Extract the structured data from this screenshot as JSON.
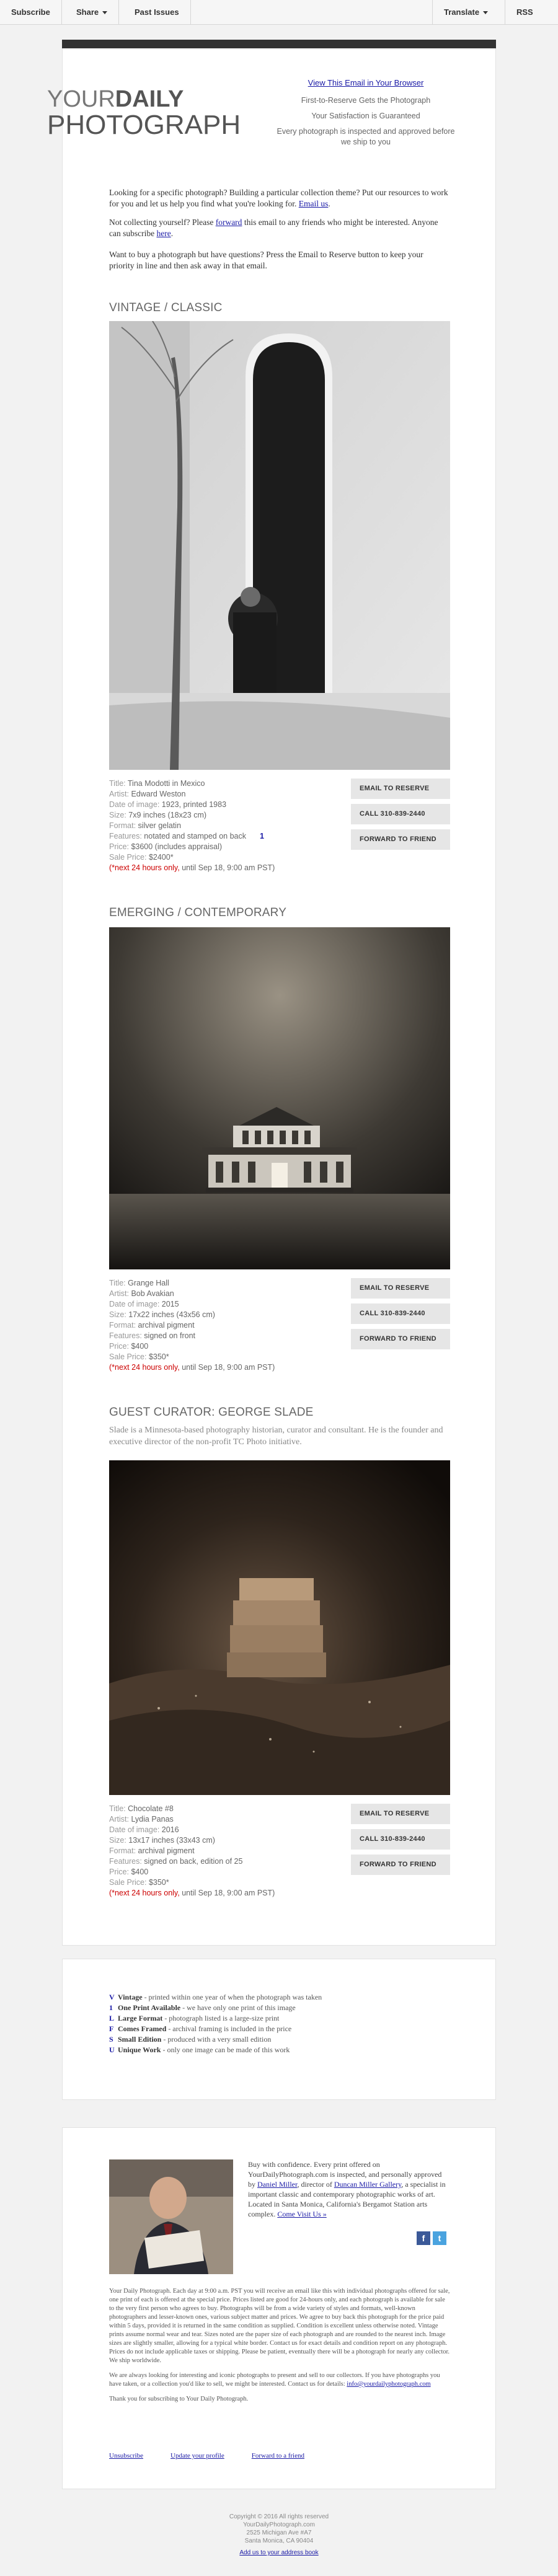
{
  "topbar": {
    "subscribe": "Subscribe",
    "share": "Share",
    "past_issues": "Past Issues",
    "translate": "Translate",
    "rss": "RSS"
  },
  "header": {
    "logo_line1_a": "YOUR",
    "logo_line1_b": "DAILY",
    "logo_line2": "PHOTOGRAPH",
    "view_in_browser": "View This Email in Your Browser",
    "tagline1": "First-to-Reserve Gets the Photograph",
    "tagline2": "Your Satisfaction is Guaranteed",
    "tagline3": "Every photograph is inspected and approved before we ship to you"
  },
  "intro": {
    "p1_text": "Looking for a specific photograph? Building a particular collection theme? Put our resources to work for you and let us help you find what you're looking for.",
    "p1_link": "Email us",
    "p2_a": "Not collecting yourself? Please",
    "p2_link1": "forward",
    "p2_b": "this email to any friends who might be interested. Anyone can subscribe",
    "p2_link2": "here",
    "p3": "Want to buy a photograph but have questions? Press the Email to Reserve button to keep your priority in line and then ask away in that email."
  },
  "sections": [
    {
      "heading": "VINTAGE / CLASSIC",
      "title": "Tina Modotti in Mexico",
      "artist": "Edward Weston",
      "date": "1923, printed 1983",
      "size": "7x9 inches (18x23 cm)",
      "format": "silver gelatin",
      "features": "notated and stamped on back",
      "badge": "1",
      "price": "$3600 (includes appraisal)",
      "sale_price": "$2400*",
      "deadline_red": "(*next 24 hours only,",
      "deadline_rest": "until Sep 18, 9:00 am PST)"
    },
    {
      "heading": "EMERGING / CONTEMPORARY",
      "title": "Grange Hall",
      "artist": "Bob Avakian",
      "date": "2015",
      "size": "17x22 inches (43x56 cm)",
      "format": "archival pigment",
      "features": "signed on front",
      "price": "$400",
      "sale_price": "$350*",
      "deadline_red": "(*next 24 hours only,",
      "deadline_rest": "until Sep 18, 9:00 am PST)"
    },
    {
      "heading": "GUEST CURATOR: GEORGE SLADE",
      "curator_desc": "Slade is a Minnesota-based photography historian, curator and consultant. He is the founder and executive director of the non-profit TC Photo initiative.",
      "title": "Chocolate #8",
      "artist": "Lydia Panas",
      "date": "2016",
      "size": "13x17 inches (33x43 cm)",
      "format": "archival pigment",
      "features": "signed on back, edition of 25",
      "price": "$400",
      "sale_price": "$350*",
      "deadline_red": "(*next 24 hours only,",
      "deadline_rest": "until Sep 18, 9:00 am PST)"
    }
  ],
  "labels": {
    "title": "Title:",
    "artist": "Artist:",
    "date": "Date of image:",
    "size": "Size:",
    "format": "Format:",
    "features": "Features:",
    "price": "Price:",
    "sale_price": "Sale Price:"
  },
  "buttons": {
    "reserve": "EMAIL TO RESERVE",
    "call": "CALL 310-839-2440",
    "forward": "FORWARD TO FRIEND"
  },
  "legend": [
    {
      "code": "V",
      "name": "Vintage",
      "desc": "- printed within one year of when the photograph was taken"
    },
    {
      "code": "1",
      "name": "One Print Available",
      "desc": "- we have only one print of this image"
    },
    {
      "code": "L",
      "name": "Large Format",
      "desc": "- photograph listed is a large-size print"
    },
    {
      "code": "F",
      "name": "Comes Framed",
      "desc": "- archival framing is included in the price"
    },
    {
      "code": "S",
      "name": "Small Edition",
      "desc": "- produced with a very small edition"
    },
    {
      "code": "U",
      "name": "Unique Work",
      "desc": "- only one image can be made of this work"
    }
  ],
  "about": {
    "p1": "Buy with confidence. Every print offered on YourDailyPhotograph.com is inspected, and personally approved by",
    "link1": "Daniel Miller",
    "p1b": ", director of",
    "link2": "Duncan Miller Gallery",
    "p1c": ", a specialist in important classic and contemporary photographic works of art. Located in Santa Monica, California's Bergamot Station arts complex.",
    "link3": "Come Visit Us »"
  },
  "social": {
    "facebook": "f",
    "twitter": "t"
  },
  "smallprint": {
    "p1": "Your Daily Photograph. Each day at 9:00 a.m. PST you will receive an email like this with individual photographs offered for sale, one print of each is offered at the special price. Prices listed are good for 24-hours only, and each photograph is available for sale to the very first person who agrees to buy. Photographs will be from a wide variety of styles and formats, well-known photographers and lesser-known ones, various subject matter and prices. We agree to buy back this photograph for the price paid within 5 days, provided it is returned in the same condition as supplied. Condition is excellent unless otherwise noted. Vintage prints assume normal wear and tear. Sizes noted are the paper size of each photograph and are rounded to the nearest inch. Image sizes are slightly smaller, allowing for a typical white border. Contact us for exact details and condition report on any photograph. Prices do not include applicable taxes or shipping. Please be patient, eventually there will be a photograph for nearly any collector. We ship worldwide.",
    "p2": "We are always looking for interesting and iconic photographs to present and sell to our collectors. If you have photographs you have taken, or a collection you'd like to sell, we might be interested. Contact us for details:",
    "p2_email": "info@yourdailyphotograph.com",
    "p3": "Thank you for subscribing to Your Daily Photograph."
  },
  "footer_links": {
    "unsubscribe": "Unsubscribe",
    "update": "Update your profile",
    "forward": "Forward to a friend"
  },
  "copyright": {
    "line1": "Copyright © 2016 All rights reserved",
    "line2": "YourDailyPhotograph.com",
    "line3": "2525 Michigan Ave #A7",
    "line4": "Santa Monica, CA 90404",
    "add": "Add us to your address book"
  },
  "colors": {
    "link": "#1a1aa6",
    "red": "#cc0000",
    "button_bg": "#e6e6e6",
    "dark_bar": "#333333"
  }
}
